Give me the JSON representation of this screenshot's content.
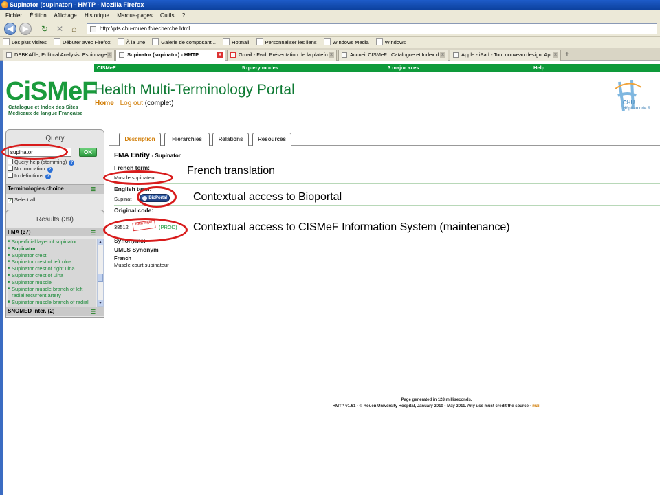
{
  "browser": {
    "title": "Supinator (supinator) - HMTP - Mozilla Firefox",
    "menus": [
      "Fichier",
      "Édition",
      "Affichage",
      "Historique",
      "Marque-pages",
      "Outils",
      "?"
    ],
    "url": "http://pts.chu-rouen.fr/recherche.html",
    "bookmarks": [
      "Les plus visités",
      "Débuter avec Firefox",
      "À la une",
      "Galerie de composant...",
      "Hotmail",
      "Personnaliser les liens",
      "Windows Media",
      "Windows"
    ],
    "tabs": [
      {
        "label": "DEBKAfile, Political Analysis, Espionage..."
      },
      {
        "label": "Supinator (supinator) - HMTP"
      },
      {
        "label": "Gmail - Fwd: Présentation de la platefo..."
      },
      {
        "label": "Accueil CISMeF : Catalogue et Index d..."
      },
      {
        "label": "Apple - iPad - Tout nouveau design. Ap..."
      }
    ]
  },
  "site": {
    "nav": [
      "CISMeF",
      "5 query modes",
      "3 major axes",
      "Help"
    ],
    "logo_text": "CiSMeF",
    "logo_sub": "Catalogue et Index des Sites Médicaux de langue Française",
    "title": "Health Multi-Terminology Portal",
    "home": "Home",
    "logout": "Log out",
    "mode": "(complet)",
    "chu_label": "CHU",
    "chu_sub": "Hôpitaux de R"
  },
  "query": {
    "title": "Query",
    "value": "supinator",
    "ok": "OK",
    "options": [
      "Query help (stemming)",
      "No truncation",
      "In definitions"
    ],
    "terminologies_title": "Terminologies choice",
    "select_all": "Select all"
  },
  "results": {
    "title": "Results (39)",
    "fma_head": "FMA (37)",
    "items": [
      "Superficial layer of supinator",
      "Supinator",
      "Supinator crest",
      "Supinator crest of left ulna",
      "Supinator crest of right ulna",
      "Supinator crest of ulna",
      "Supinator muscle",
      "Supinator muscle branch of left radial recurrent artery",
      "Supinator muscle branch of radial"
    ],
    "snomed_head": "SNOMED inter. (2)"
  },
  "tabs": [
    "Description",
    "Hierarchies",
    "Relations",
    "Resources"
  ],
  "entity": {
    "type": "FMA Entity",
    "name": "- Supinator",
    "french_label": "French term:",
    "french_value": "Muscle supinateur",
    "english_label": "English term:",
    "english_value": "Supinat",
    "bioportal": "BioPortal",
    "original_label": "Original code:",
    "code": "38512",
    "stamp": "Bien réglé",
    "prod": "(PROD)",
    "synonyms_label": "Synonyms:",
    "umls_label": "UMLS Synonym",
    "lang": "French",
    "synonym": "Muscle court supinateur"
  },
  "annotations": [
    "French translation",
    "Contextual access to Bioportal",
    "Contextual access to CISMeF Information System (maintenance)"
  ],
  "footer": {
    "line1": "Page generated in 128 milliseconds.",
    "line2": "HMTP v1.61 - © Rouen University Hospital, January 2010 - May 2011. Any use must credit the source -",
    "mail": "mail"
  },
  "colors": {
    "green": "#0e9a3a",
    "orange": "#d07a00",
    "annotation_red": "#d81b1b"
  }
}
